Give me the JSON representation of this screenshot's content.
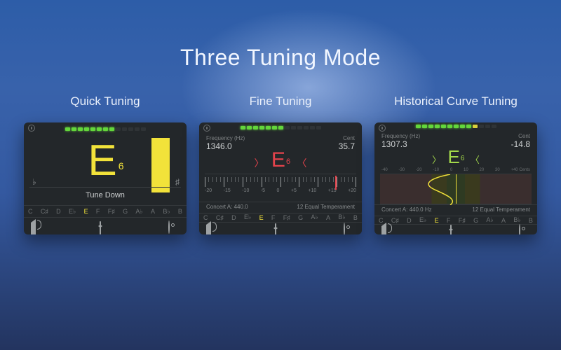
{
  "headline": "Three Tuning Mode",
  "columns": [
    {
      "title": "Quick Tuning"
    },
    {
      "title": "Fine Tuning"
    },
    {
      "title": "Historical Curve Tuning"
    }
  ],
  "note_strip": [
    "C",
    "C♯",
    "D",
    "E♭",
    "E",
    "F",
    "F♯",
    "G",
    "A♭",
    "A",
    "B♭",
    "B"
  ],
  "active_note_index": 4,
  "quick": {
    "note": "E",
    "octave": "6",
    "hint": "Tune Down",
    "flat": "♭",
    "sharp": "♯"
  },
  "fine": {
    "freq_label": "Frequency (Hz)",
    "freq_value": "1346.0",
    "cent_label": "Cent",
    "cent_value": "35.7",
    "note": "E",
    "octave": "6",
    "scale_numbers": [
      "-20",
      "-15",
      "-10",
      "-5",
      "0",
      "+5",
      "+10",
      "+15",
      "+20"
    ],
    "concert_a_label": "Concert A:",
    "concert_a_value": "440.0",
    "temperament": "12 Equal Temperament",
    "needle_percent": 86
  },
  "hist": {
    "freq_label": "Frequency (Hz)",
    "freq_value": "1307.3",
    "cent_label": "Cent",
    "cent_value": "-14.8",
    "note": "E",
    "octave": "6",
    "scale_numbers": [
      "-40",
      "-30",
      "-20",
      "-10",
      "0",
      "10",
      "20",
      "30",
      "+40 Cents"
    ],
    "concert_a_label": "Concert A:",
    "concert_a_value": "440.0",
    "concert_a_unit": "Hz",
    "temperament": "12 Equal Temperament"
  }
}
